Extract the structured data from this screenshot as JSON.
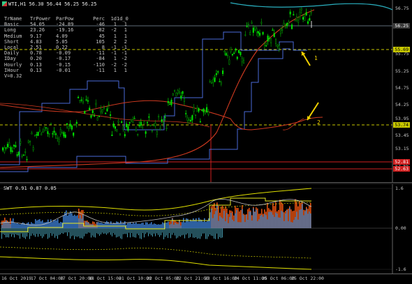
{
  "chart": {
    "symbol_title": "WTI,H1  56.30 56.44 56.25 56.25",
    "stats": {
      "headers": [
        "TrName",
        "TrPower",
        "ParPow",
        "Perc",
        "1d",
        "1d_0"
      ],
      "rows": [
        [
          "Basic",
          "54.05",
          "-24.89",
          "-46",
          "1",
          "1"
        ],
        [
          "Long",
          "23.26",
          "-19.16",
          "-82",
          "-2",
          "1"
        ],
        [
          "Medium",
          "9.17",
          "4.09",
          "45",
          "1",
          "1"
        ],
        [
          "Short",
          "4.83",
          "5.05",
          "105",
          "2",
          "2"
        ],
        [
          "Local",
          "2.51",
          "0.22",
          "8",
          "-1",
          "-1"
        ],
        [
          "Daily",
          "0.78",
          "-0.09",
          "-11",
          "-1",
          "-1"
        ],
        [
          "IDay",
          "0.20",
          "-0.17",
          "-84",
          "1",
          "-2"
        ],
        [
          "Hourly",
          "0.13",
          "-0.15",
          "-110",
          "-2",
          "-2"
        ],
        [
          "IHour",
          "0.13",
          "-0.01",
          "-11",
          "1",
          "1"
        ]
      ],
      "footer": "V=0.32"
    },
    "price_axis": [
      "56.75",
      "56.25",
      "55.75",
      "55.25",
      "54.75",
      "54.25",
      "53.95",
      "53.45",
      "53.15",
      "52.65"
    ],
    "price_tags": [
      {
        "text": "56.25",
        "color": "#ffffff",
        "bg": "#3a3a3a"
      },
      {
        "text": "55.69",
        "color": "#000000",
        "bg": "#c8c800"
      },
      {
        "text": "53.74",
        "color": "#000000",
        "bg": "#c8c800"
      },
      {
        "text": "52.81",
        "color": "#ffffff",
        "bg": "#d02020"
      },
      {
        "text": "52.63",
        "color": "#ffffff",
        "bg": "#d02020"
      }
    ],
    "annotations": [
      "1",
      "2"
    ]
  },
  "subwindow": {
    "title": "SWT 0.91 0.87 0.05",
    "axis": [
      "1.6",
      "0.00",
      "-1.6"
    ]
  },
  "time_axis": [
    "16 Oct 2019",
    "17 Oct 04:00",
    "17 Oct 20:00",
    "18 Oct 15:00",
    "21 Oct 10:00",
    "22 Oct 05:00",
    "22 Oct 21:00",
    "23 Oct 16:00",
    "24 Oct 11:00",
    "25 Oct 06:00",
    "25 Oct 22:00"
  ],
  "colors": {
    "bull_candle": "#00e000",
    "bear_candle": "#00a000",
    "ma_red": "#d03a20",
    "channel_blue": "#4a6ad8",
    "cyan_band": "#2ab0c0",
    "yellow_dash": "#c8c800",
    "arrow": "#f0d000"
  }
}
